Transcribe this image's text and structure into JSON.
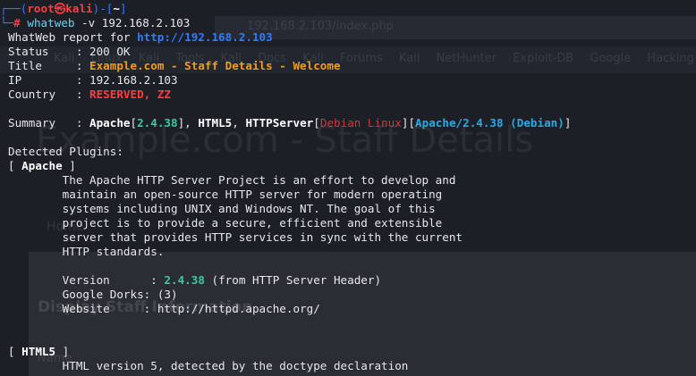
{
  "prompt": {
    "frame_start": "┌──(",
    "user": "root",
    "at": "㉿",
    "host": "kali",
    "frame_mid": ")-[",
    "dir": "~",
    "frame_end": "]",
    "line2": "└─",
    "hash": "#",
    "command_name": "whatweb",
    "command_args": " -v 192.168.2.103"
  },
  "report": {
    "header_label": "WhatWeb report for ",
    "url": "http://192.168.2.103",
    "status_label": "Status    : ",
    "status": "200 OK",
    "title_label": "Title     : ",
    "title": "Example.com - Staff Details - Welcome",
    "ip_label": "IP        : ",
    "ip": "192.168.2.103",
    "country_label": "Country   : ",
    "country": "RESERVED, ZZ",
    "summary_label": "Summary   : ",
    "summary": {
      "apache": "Apache",
      "apache_ver": "2.4.38",
      "html5": "HTML5",
      "httpserver": "HTTPServer",
      "debian": "Debian Linux",
      "server_string": "Apache/2.4.38 (Debian)"
    }
  },
  "plugins": {
    "heading": "Detected Plugins:",
    "apache": {
      "name": "Apache",
      "desc": [
        "The Apache HTTP Server Project is an effort to develop and",
        "maintain an open-source HTTP server for modern operating",
        "systems including UNIX and Windows NT. The goal of this",
        "project is to provide a secure, efficient and extensible",
        "server that provides HTTP services in sync with the current",
        "HTTP standards."
      ],
      "version_label": "Version      : ",
      "version": "2.4.38",
      "version_note": " (from HTTP Server Header)",
      "dorks_label": "Google Dorks: ",
      "dorks": "(3)",
      "website_label": "Website     : ",
      "website": "http://httpd.apache.org/"
    },
    "html5": {
      "name": "HTML5",
      "desc": "HTML version 5, detected by the doctype declaration"
    }
  },
  "background": {
    "url": "192.168.2.103/index.php",
    "bookmarks": "Kali Linux  Kali Tools  Kali Docs  Kali Forums  Kali NetHunter  Exploit-DB  Google Hacking",
    "heading": "Example.com - Staff Details",
    "nav": "Home",
    "section": "Display Staff Information",
    "name": "Name"
  }
}
